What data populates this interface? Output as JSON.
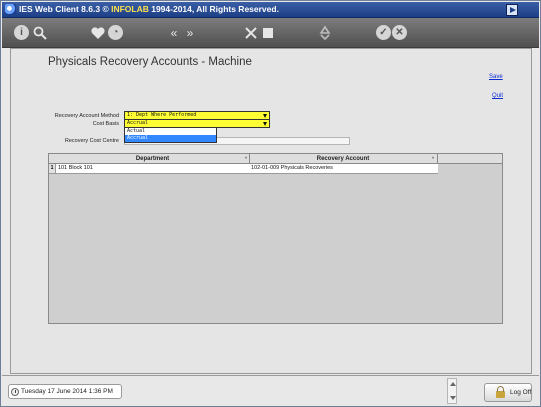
{
  "window": {
    "title_prefix": "IES Web Client 8.6.3 © ",
    "brand": "INFOLAB",
    "title_suffix": " 1994-2014, All Rights Reserved."
  },
  "toolbar": {
    "icons": [
      "info-icon",
      "search-icon",
      "heart-icon",
      "clock-icon",
      "rewind-icon",
      "fast-forward-icon",
      "tools-icon",
      "stop-icon",
      "recycle-icon",
      "check-icon",
      "close-icon"
    ]
  },
  "page": {
    "title": "Physicals Recovery Accounts - Machine",
    "save_link": "Save",
    "quit_link": "Quit"
  },
  "form": {
    "recovery_account_method": {
      "label": "Recovery Account Method",
      "value": "1: Dept Where Performed"
    },
    "cost_basis": {
      "label": "Cost Basis",
      "value": "Accrual",
      "options": [
        "Actual",
        "Accrual"
      ],
      "selected": "Accrual"
    },
    "recovery_cost_centre": {
      "label": "Recovery Cost Centre"
    }
  },
  "grid": {
    "columns": [
      "Department",
      "Recovery Account"
    ],
    "rows": [
      {
        "num": "1",
        "department": "101 Block 101",
        "recovery_account": "102-01-009 Physicals Recoveries"
      }
    ]
  },
  "status": {
    "date": "Tuesday 17 June 2014 1:36 PM",
    "logoff": "Log Off"
  },
  "colors": {
    "titlebar": "#1d3f86",
    "select_bg": "#ffff33",
    "selected_option": "#3388ff",
    "link": "#0b2bd6"
  }
}
